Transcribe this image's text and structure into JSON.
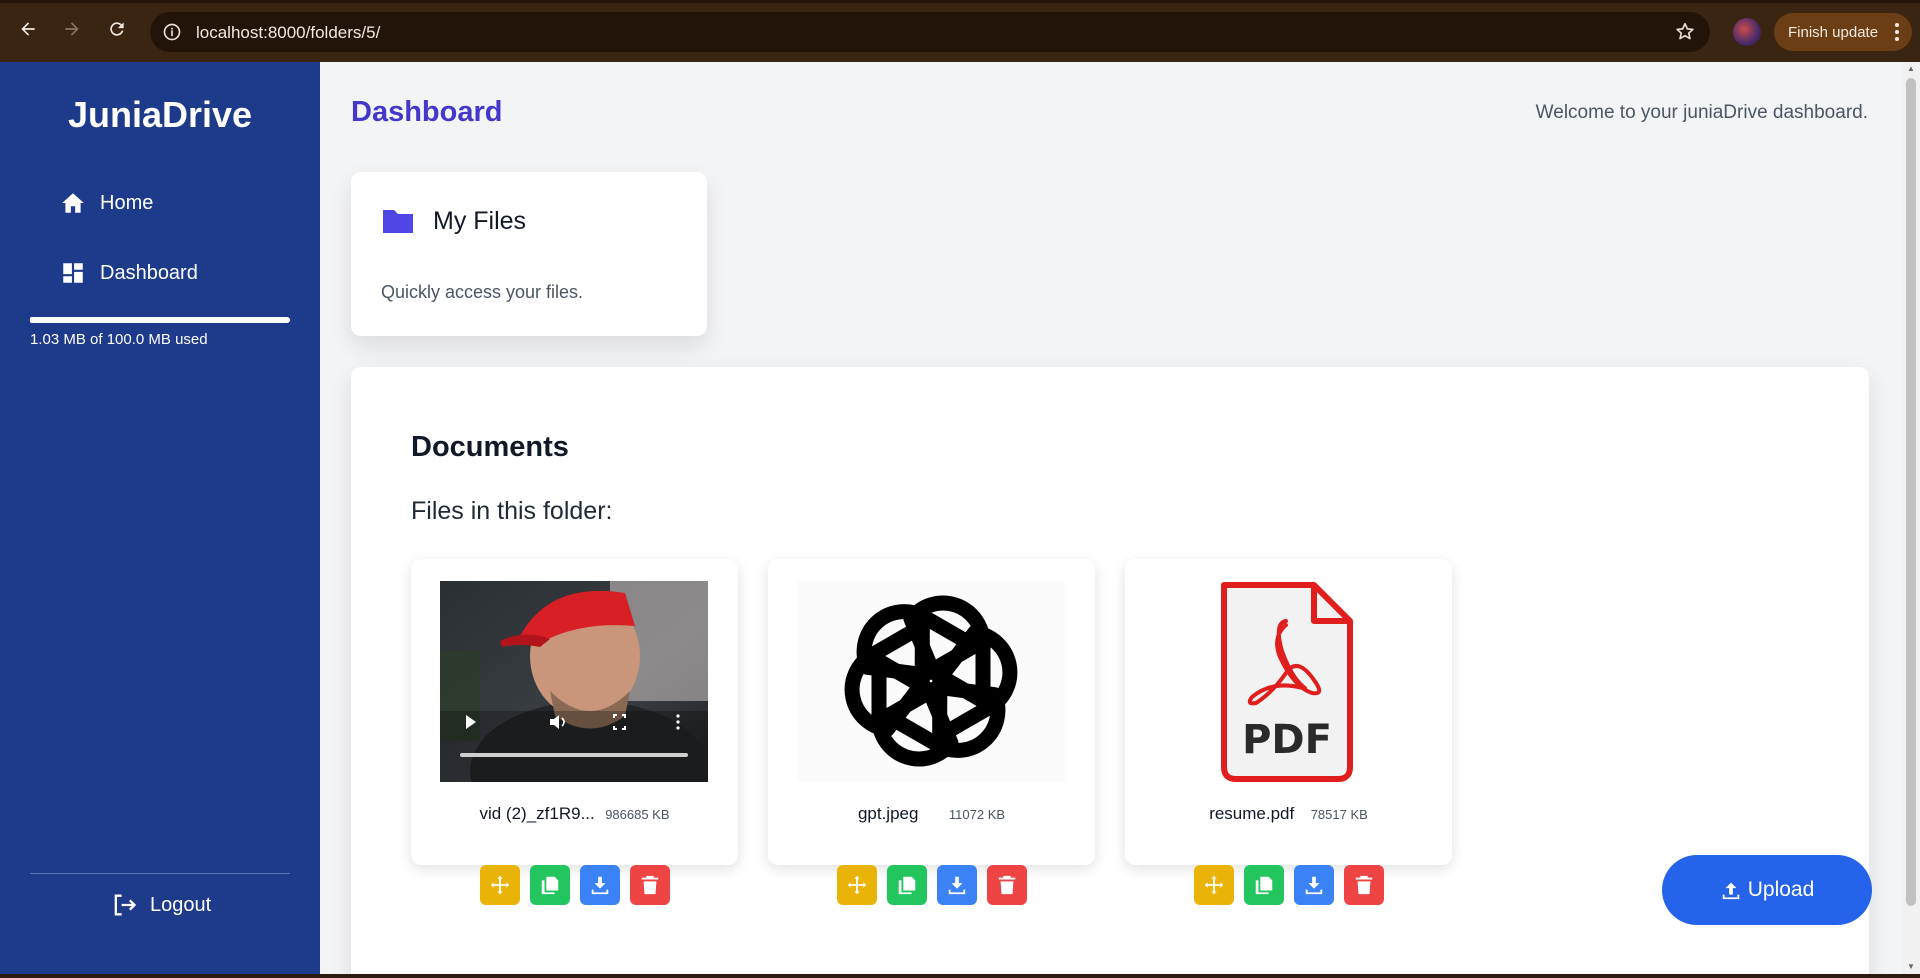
{
  "browser": {
    "url": "localhost:8000/folders/5/",
    "finish_update_label": "Finish update"
  },
  "sidebar": {
    "brand": "JuniaDrive",
    "items": [
      {
        "label": "Home",
        "icon": "home-icon"
      },
      {
        "label": "Dashboard",
        "icon": "dashboard-icon"
      }
    ],
    "storage": {
      "used_fraction": 0.0103,
      "text": "1.03 MB of 100.0 MB used"
    },
    "logout_label": "Logout"
  },
  "header": {
    "title": "Dashboard",
    "welcome": "Welcome to your juniaDrive dashboard."
  },
  "my_files_card": {
    "title": "My Files",
    "description": "Quickly access your files."
  },
  "documents": {
    "title": "Documents",
    "subtitle": "Files in this folder:",
    "files": [
      {
        "name": "vid (2)_zf1R9...",
        "size": "986685 KB",
        "type": "video"
      },
      {
        "name": "gpt.jpeg",
        "size": "11072 KB",
        "type": "image"
      },
      {
        "name": "resume.pdf",
        "size": "78517 KB",
        "type": "pdf"
      }
    ],
    "pdf_thumb_label": "PDF"
  },
  "upload_label": "Upload",
  "colors": {
    "sidebar": "#1e3a8a",
    "title": "#4338ca",
    "move": "#eab308",
    "copy": "#22c55e",
    "download": "#3b82f6",
    "delete": "#ef4444",
    "upload": "#2563eb"
  }
}
